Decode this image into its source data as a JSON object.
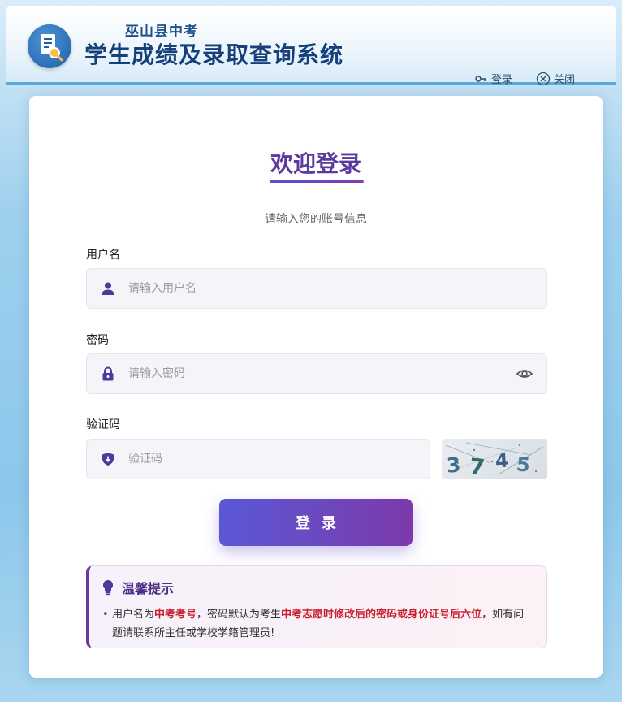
{
  "header": {
    "subtitle": "巫山县中考",
    "title": "学生成绩及录取查询系统",
    "login_link": "登录",
    "close_link": "关闭"
  },
  "login": {
    "welcome": "欢迎登录",
    "hint": "请输入您的账号信息",
    "username_label": "用户名",
    "username_placeholder": "请输入用户名",
    "password_label": "密码",
    "password_placeholder": "请输入密码",
    "captcha_label": "验证码",
    "captcha_placeholder": "验证码",
    "captcha_code": "3745",
    "submit": "登录"
  },
  "tips": {
    "title": "温馨提示",
    "bullet": "•",
    "part1": "用户名为",
    "part2": "中考考号",
    "part3": "，密码默认为考生",
    "part4": "中考志愿时修改后的密码或身份证号后六位",
    "part5": "，如有问题请联系所主任或学校学籍管理员!"
  },
  "colors": {
    "accent": "#5b3a9e",
    "header_title": "#16407c",
    "button_start": "#5a58d6",
    "button_end": "#7c3aaa",
    "warning_red": "#c81e2c"
  },
  "icons": {
    "logo": "document-search-icon",
    "login": "key-icon",
    "close": "close-circle-icon",
    "user": "user-icon",
    "lock": "lock-icon",
    "eye": "eye-icon",
    "shield": "shield-icon",
    "tip": "lightbulb-icon"
  }
}
